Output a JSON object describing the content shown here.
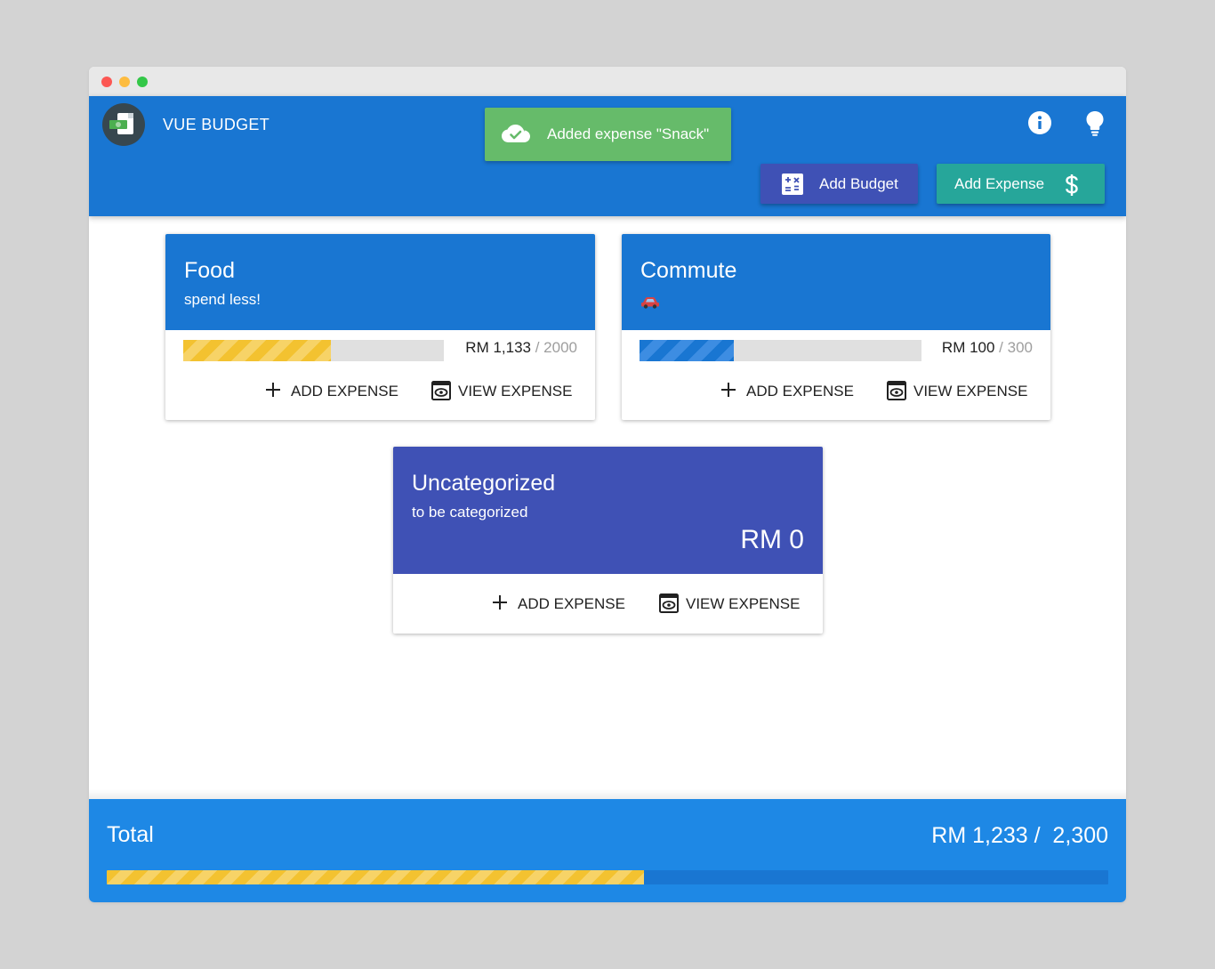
{
  "app": {
    "title": "VUE BUDGET"
  },
  "toast": {
    "text": "Added expense \"Snack\""
  },
  "header": {
    "info_icon": "info-icon",
    "bulb_icon": "lightbulb-icon",
    "add_budget_label": "Add Budget",
    "add_expense_label": "Add Expense"
  },
  "colors": {
    "header": "#1976d2",
    "toast": "#66bb6a",
    "add_budget": "#3f51b5",
    "add_expense": "#26a69a",
    "progress_yellow": "#f3c230",
    "progress_blue": "#1976d2",
    "uncategorized": "#3f51b5",
    "footer": "#1e88e5"
  },
  "budgets": [
    {
      "title": "Food",
      "subtitle": "spend less!",
      "spent": "RM 1,133",
      "separator": " / ",
      "total": "2000",
      "progress": 0.5665,
      "bar_color": "yellow",
      "add_label": "ADD EXPENSE",
      "view_label": "VIEW EXPENSE"
    },
    {
      "title": "Commute",
      "subtitle_icon": "car-icon",
      "spent": "RM 100",
      "separator": " / ",
      "total": "300",
      "progress": 0.3333,
      "bar_color": "blue",
      "add_label": "ADD EXPENSE",
      "view_label": "VIEW EXPENSE"
    },
    {
      "title": "Uncategorized",
      "subtitle": "to be categorized",
      "amount": "RM 0",
      "add_label": "ADD EXPENSE",
      "view_label": "VIEW EXPENSE"
    }
  ],
  "footer": {
    "label": "Total",
    "amount": "RM 1,233 /  2,300",
    "progress": 0.536
  }
}
